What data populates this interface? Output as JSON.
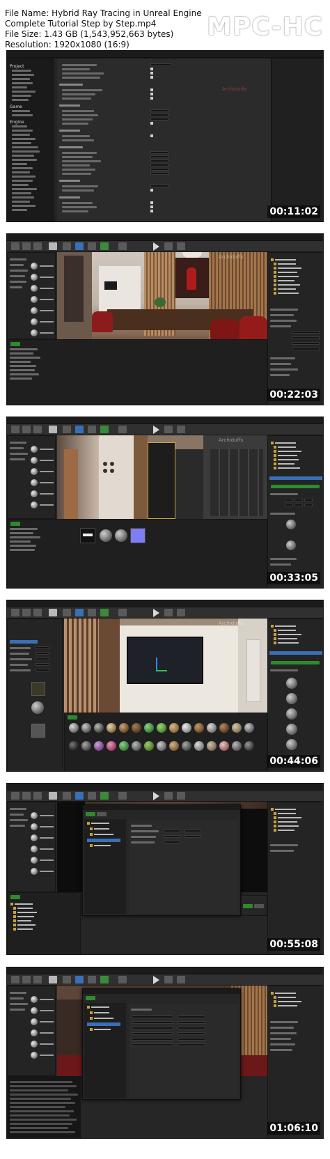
{
  "header": {
    "line1": "File Name: Hybrid Ray Tracing in Unreal Engine",
    "line2": "Complete Tutorial Step by Step.mp4",
    "line3": "File Size: 1.43 GB (1,543,952,663 bytes)",
    "line4": "Resolution: 1920x1080 (16:9)",
    "logo": "MPC-HC"
  },
  "watermark": "Archiduffs",
  "frames": [
    {
      "timestamp": "00:11:02",
      "view": "project-settings"
    },
    {
      "timestamp": "00:22:03",
      "view": "dining-room-viewport"
    },
    {
      "timestamp": "00:33:05",
      "view": "hallway-viewport-with-materials"
    },
    {
      "timestamp": "00:44:06",
      "view": "tv-wall-material-browser"
    },
    {
      "timestamp": "00:55:08",
      "view": "dialog-window-dark-viewport"
    },
    {
      "timestamp": "01:06:10",
      "view": "dialog-window-red-room"
    }
  ],
  "project_settings": {
    "sidebar": [
      "Project",
      "Game",
      "Engine"
    ]
  },
  "colors": {
    "ue_bg": "#262626",
    "ue_panel": "#242424",
    "ue_accent_blue": "#3b6fb6",
    "ue_green": "#2f8a2f",
    "chair_red": "#8c1c1c"
  }
}
